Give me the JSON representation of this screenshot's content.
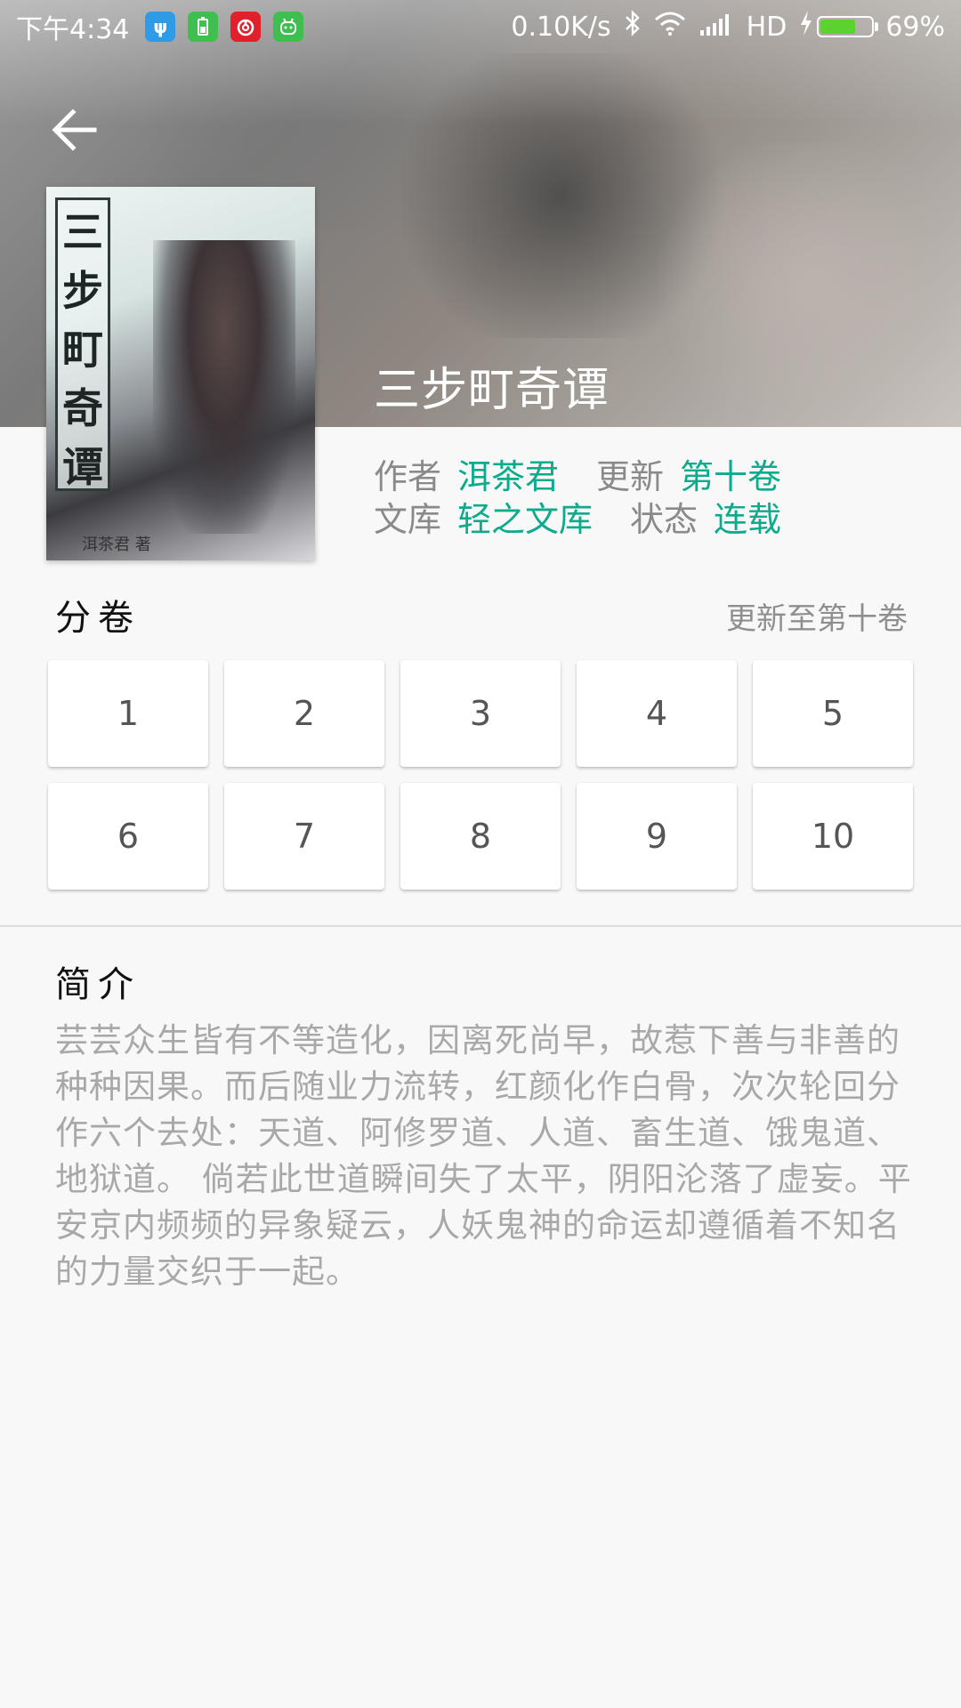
{
  "status_bar": {
    "time": "下午4:34",
    "network_speed": "0.10K/s",
    "network_type": "HD",
    "battery_percent": "69%",
    "battery_level": 0.69,
    "notification_icons": [
      "usb-icon",
      "battery-saver-icon",
      "netease-music-icon",
      "android-bot-icon"
    ],
    "colors": {
      "usb": "#2f9be6",
      "battery_saver": "#3fbf4f",
      "netease": "#e0202a",
      "bot": "#3fbf4f",
      "battery_fill": "#5cd22e"
    }
  },
  "book": {
    "title": "三步町奇谭",
    "cover_text": [
      "三",
      "步",
      "町",
      "奇",
      "谭"
    ],
    "cover_author_strip": "洱茶君 著",
    "info": {
      "author_label": "作者",
      "author": "洱茶君",
      "update_label": "更新",
      "update": "第十卷",
      "library_label": "文库",
      "library": "轻之文库",
      "status_label": "状态",
      "status": "连载"
    }
  },
  "volumes": {
    "title": "分卷",
    "subtitle": "更新至第十卷",
    "items": [
      "1",
      "2",
      "3",
      "4",
      "5",
      "6",
      "7",
      "8",
      "9",
      "10"
    ]
  },
  "intro": {
    "title": "简介",
    "text": "芸芸众生皆有不等造化，因离死尚早，故惹下善与非善的种种因果。而后随业力流转，红颜化作白骨，次次轮回分作六个去处：天道、阿修罗道、人道、畜生道、饿鬼道、地狱道。 倘若此世道瞬间失了太平，阴阳沦落了虚妄。平安京内频频的异象疑云，人妖鬼神的命运却遵循着不知名的力量交织于一起。"
  },
  "accent_color": "#0bab8c"
}
